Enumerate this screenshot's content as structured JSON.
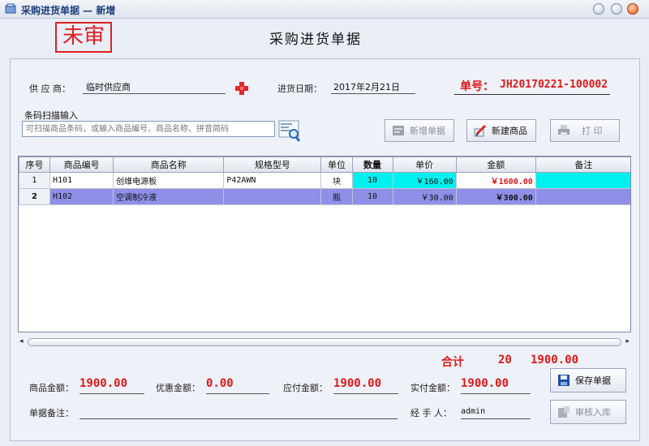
{
  "window": {
    "title": "采购进货单据 — 新增"
  },
  "header": {
    "stamp": "未审",
    "form_title": "采购进货单据"
  },
  "form": {
    "supplier_label": "供 应 商：",
    "supplier_value": "临时供应商",
    "date_label": "进货日期：",
    "date_value": "2017年2月21日",
    "bill_no_label": "单号：",
    "bill_no_value": "JH20170221-100002"
  },
  "scan": {
    "group_label": "条码扫描输入",
    "placeholder": "可扫描商品条码，或输入商品编号、商品名称、拼音简码"
  },
  "toolbar": {
    "new_bill_label": "新增单据",
    "new_goods_label": "新建商品",
    "print_label": "打 印"
  },
  "table": {
    "columns": [
      "序号",
      "商品编号",
      "商品名称",
      "规格型号",
      "单位",
      "数量",
      "单价",
      "金额",
      "备注"
    ],
    "rows": [
      {
        "seq": "1",
        "code": "H101",
        "name": "创维电源板",
        "spec": "P42AWN",
        "unit": "块",
        "qty": "10",
        "price": "￥160.00",
        "amount": "￥1600.00",
        "note": ""
      },
      {
        "seq": "2",
        "code": "H102",
        "name": "空调制冷液",
        "spec": "",
        "unit": "瓶",
        "qty": "10",
        "price": "￥30.00",
        "amount": "￥300.00",
        "note": ""
      }
    ]
  },
  "totals": {
    "label": "合计",
    "qty": "20",
    "amount": "1900.00"
  },
  "summary": {
    "goods_amount_label": "商品金额：",
    "goods_amount_value": "1900.00",
    "discount_label": "优惠金额：",
    "discount_value": "0.00",
    "payable_label": "应付金额：",
    "payable_value": "1900.00",
    "paid_label": "实付金额：",
    "paid_value": "1900.00",
    "remark_label": "单据备注：",
    "remark_value": "",
    "handler_label": "经 手 人：",
    "handler_value": "admin"
  },
  "actions": {
    "save_label": "保存单据",
    "audit_label": "审核入库"
  },
  "colors": {
    "accent_red": "#e01818",
    "selected_row": "#8f8fe8",
    "cyan_cell": "#00f0f0"
  }
}
